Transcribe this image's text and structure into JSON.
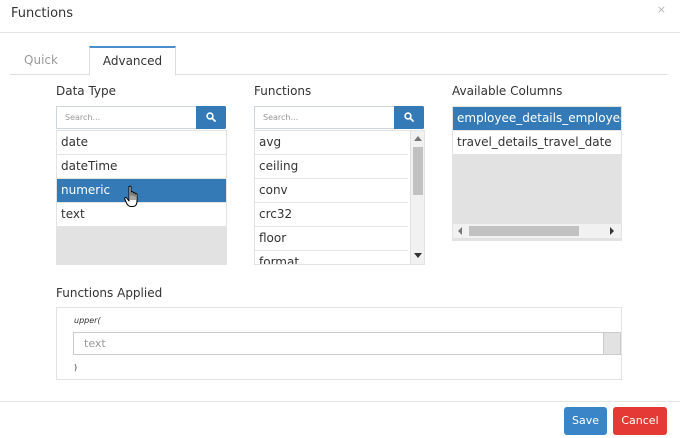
{
  "dialog": {
    "title": "Functions",
    "close_glyph": "×"
  },
  "tabs": [
    {
      "label": "Quick",
      "active": false
    },
    {
      "label": "Advanced",
      "active": true
    }
  ],
  "data_type": {
    "label": "Data Type",
    "search_placeholder": "Search...",
    "items": [
      "date",
      "dateTime",
      "numeric",
      "text"
    ],
    "selected": "numeric"
  },
  "functions": {
    "label": "Functions",
    "search_placeholder": "Search...",
    "items": [
      "avg",
      "ceiling",
      "conv",
      "crc32",
      "floor",
      "format"
    ]
  },
  "available_columns": {
    "label": "Available Columns",
    "items": [
      "employee_details_employee",
      "travel_details_travel_date"
    ],
    "selected": "employee_details_employee"
  },
  "functions_applied": {
    "label": "Functions Applied",
    "open_text": "upper(",
    "argument_value": "text",
    "close_text": ")"
  },
  "footer": {
    "save_label": "Save",
    "cancel_label": "Cancel"
  },
  "colors": {
    "accent": "#337ab7",
    "cancel": "#e53935",
    "tab_active_border": "#4a8ecb"
  }
}
